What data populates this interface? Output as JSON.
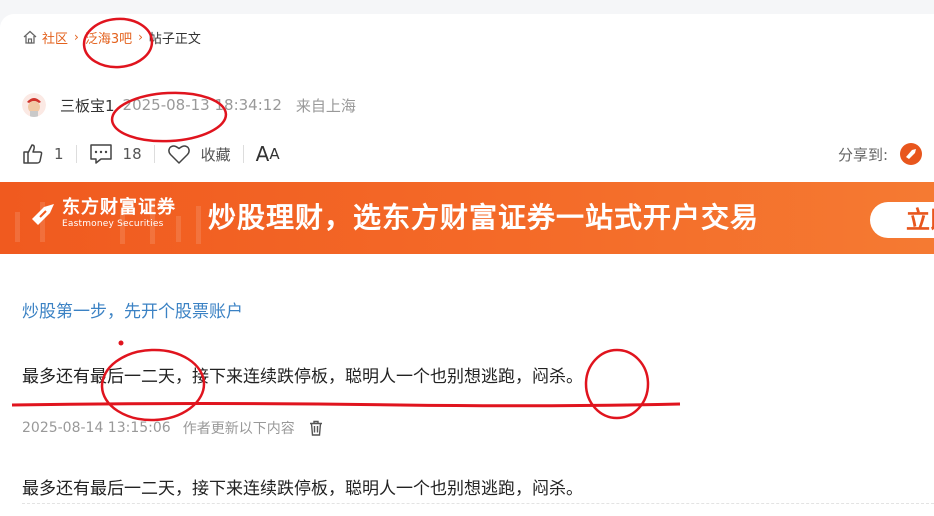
{
  "breadcrumb": {
    "home": "社区",
    "forum": "泛海3吧",
    "current": "帖子正文"
  },
  "author": {
    "name": "三板宝1",
    "time": "2025-08-13 18:34:12",
    "location": "来自上海"
  },
  "actions": {
    "like_count": "1",
    "comment_count": "18",
    "favorite_label": "收藏",
    "font_size_big": "A",
    "font_size_small": "A",
    "share_label": "分享到:"
  },
  "banner": {
    "logo_cn": "东方财富证券",
    "logo_en": "Eastmoney Securities",
    "slogan": "炒股理财，选东方财富证券一站式开户交易",
    "cta": "立即"
  },
  "content": {
    "promo_link": "炒股第一步，先开个股票账户",
    "body": "最多还有最后一二天，接下来连续跌停板，聪明人一个也别想逃跑，闷杀。",
    "update_time": "2025-08-14 13:15:06",
    "update_label": "作者更新以下内容",
    "update_body": "最多还有最后一二天，接下来连续跌停板，聪明人一个也别想逃跑，闷杀。"
  },
  "colors": {
    "accent": "#e3611d",
    "banner": "#f05a1f",
    "link": "#3b82c4",
    "annotation": "#e0141e"
  },
  "icons": [
    "home-icon",
    "thumbs-up-icon",
    "comment-icon",
    "heart-icon",
    "share-logo-icon",
    "trash-icon"
  ]
}
